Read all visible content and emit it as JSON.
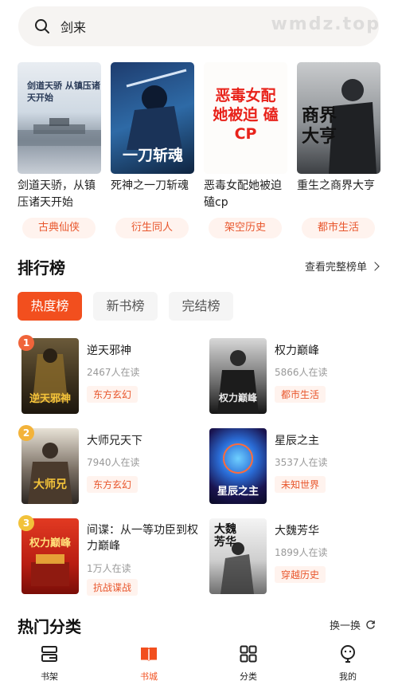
{
  "search": {
    "query": "剑来",
    "watermark": "wmdz.top"
  },
  "featured": [
    {
      "title": "剑道天骄，从镇压诸天开始",
      "tag": "古典仙侠",
      "cover_text": "剑道天骄 从镇压诸天开始"
    },
    {
      "title": "死神之一刀斩魂",
      "tag": "衍生同人",
      "cover_text": "一刀斩魂"
    },
    {
      "title": "恶毒女配她被迫磕cp",
      "tag": "架空历史",
      "cover_text": "恶毒女配 她被迫 磕CP"
    },
    {
      "title": "重生之商界大亨",
      "tag": "都市生活",
      "cover_text": "商界大亨"
    }
  ],
  "ranking": {
    "title": "排行榜",
    "more_label": "查看完整榜单",
    "tabs": [
      "热度榜",
      "新书榜",
      "完结榜"
    ],
    "items": [
      {
        "rank": "1",
        "name": "逆天邪神",
        "reads": "2467人在读",
        "genre": "东方玄幻",
        "cover_text": "逆天邪神"
      },
      {
        "rank": "",
        "name": "权力巅峰",
        "reads": "5866人在读",
        "genre": "都市生活",
        "cover_text": "权力巅峰"
      },
      {
        "rank": "2",
        "name": "大师兄天下",
        "reads": "7940人在读",
        "genre": "东方玄幻",
        "cover_text": "大师兄"
      },
      {
        "rank": "",
        "name": "星辰之主",
        "reads": "3537人在读",
        "genre": "未知世界",
        "cover_text": "星辰之主"
      },
      {
        "rank": "3",
        "name": "间谍：从一等功臣到权力巅峰",
        "reads": "1万人在读",
        "genre": "抗战谍战",
        "cover_text": "权力巅峰"
      },
      {
        "rank": "",
        "name": "大魏芳华",
        "reads": "1899人在读",
        "genre": "穿越历史",
        "cover_text": "大魏芳华"
      }
    ]
  },
  "categories": {
    "title": "热门分类",
    "refresh_label": "换一换"
  },
  "nav": [
    {
      "label": "书架",
      "icon": "bookshelf-icon"
    },
    {
      "label": "书城",
      "icon": "bookstore-icon"
    },
    {
      "label": "分类",
      "icon": "grid-icon"
    },
    {
      "label": "我的",
      "icon": "profile-icon"
    }
  ],
  "colors": {
    "accent": "#f24f1e",
    "tag_bg": "#fff3ee",
    "tag_text": "#e8562c"
  }
}
